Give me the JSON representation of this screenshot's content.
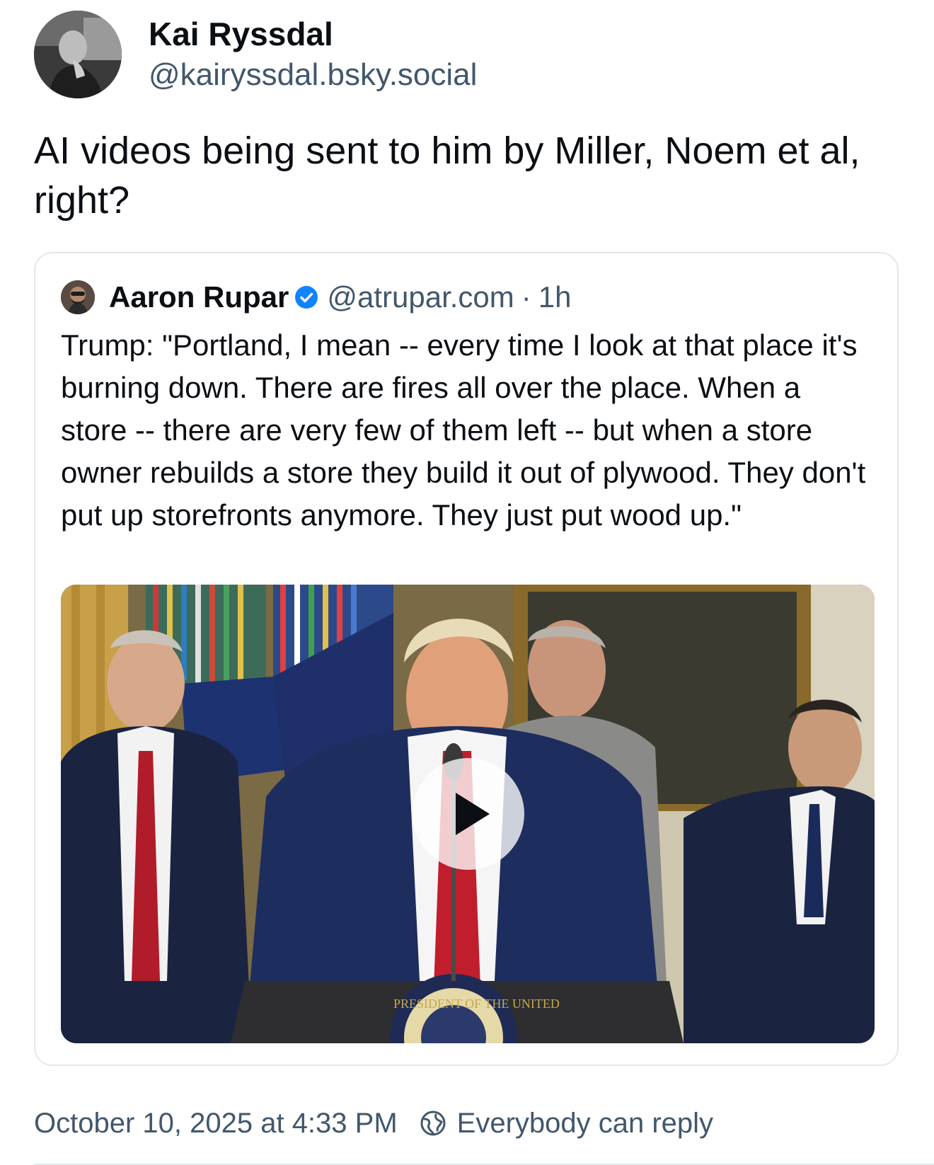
{
  "post": {
    "author": {
      "display_name": "Kai Ryssdal",
      "handle": "@kairyssdal.bsky.social"
    },
    "text": "AI videos being sent to him by Miller, Noem et al, right?",
    "quoted_post": {
      "author": {
        "display_name": "Aaron Rupar",
        "handle": "@atrupar.com",
        "separator": "·",
        "time": "1h",
        "verified": true
      },
      "text": "Trump: \"Portland, I mean -- every time I look at that place it's burning down. There are fires all over the place. When a store -- there are very few of them left -- but when a store owner rebuilds a store they build it out of plywood. They don't put up storefronts anymore. They just put wood up.\"",
      "media": {
        "type": "video",
        "play_icon": "play-icon",
        "podium_seal_text": "PRESIDENT OF THE UNITED"
      }
    },
    "footer": {
      "timestamp": "October 10, 2025 at 4:33 PM",
      "reply_icon": "globe-icon",
      "reply_setting": "Everybody can reply"
    }
  },
  "colors": {
    "text_primary": "#0b0f14",
    "text_secondary": "#42576c",
    "border": "#e3e8ee",
    "verified_blue": "#1083fe"
  }
}
